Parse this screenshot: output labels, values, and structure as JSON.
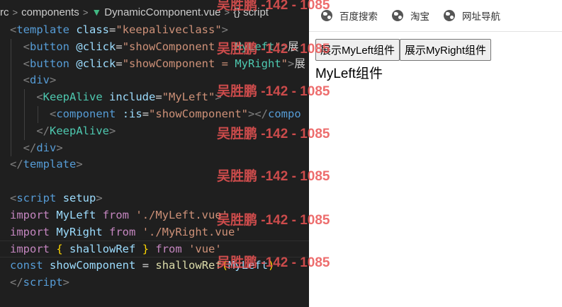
{
  "editor": {
    "breadcrumb": {
      "part1": "rc",
      "part2": "components",
      "file": "DynamicComponent.vue",
      "symbol": "script"
    },
    "code": {
      "l1_tag": "template",
      "l1_attr": "class",
      "l1_val": "\"keepaliveclass\"",
      "l2_attr": "@click",
      "l2_val_a": "\"showComponent",
      "l2_val_b": "MyLeft",
      "l2_val_c": "\"",
      "l2_text": "展",
      "l3_val_a": "\"showComponent = ",
      "l3_val_b": "MyRight",
      "l3_val_c": "\"",
      "l3_text": "展",
      "l4_tag": "div",
      "l5_tag": "KeepAlive",
      "l5_attr": "include",
      "l5_val": "\"MyLeft\"",
      "l6_tag": "component",
      "l6_attr": ":is",
      "l6_val": "\"showComponent\"",
      "l6_close": "compo",
      "l7_tag": "KeepAlive",
      "l8_tag": "div",
      "l9_tag": "template",
      "l11_tag": "script",
      "l11_attr": "setup",
      "l12_kw": "import",
      "l12_id": "MyLeft",
      "l12_from": "from",
      "l12_str": "'./MyLeft.vue'",
      "l13_kw": "import",
      "l13_id": "MyRight",
      "l13_from": "from",
      "l13_str": "'./MyRight.vue'",
      "l14_kw": "import",
      "l14_id": "shallowRef",
      "l14_from": "from",
      "l14_str": "'vue'",
      "l15_kw": "const",
      "l15_id": "showComponent",
      "l15_fn": "shallowRef",
      "l15_arg": "MyLeft",
      "l16_tag": "script"
    }
  },
  "browser": {
    "bookmarks": [
      {
        "label": "百度搜索",
        "icon": "globe-icon"
      },
      {
        "label": "淘宝",
        "icon": "globe-icon"
      },
      {
        "label": "网址导航",
        "icon": "globe-icon"
      }
    ],
    "buttons": {
      "left": "展示MyLeft组件",
      "right": "展示MyRight组件"
    },
    "component_text": "MyLeft组件"
  },
  "watermark": {
    "text": "吴胜鹏 -142 - 1085"
  },
  "colors": {
    "editor_bg": "#1f1f1f",
    "tag": "#569cd6",
    "attribute": "#9cdcfe",
    "string": "#ce9178",
    "keyword": "#c586c0",
    "function": "#dcdcaa",
    "component": "#4ec9b0",
    "watermark": "#ea5454"
  }
}
